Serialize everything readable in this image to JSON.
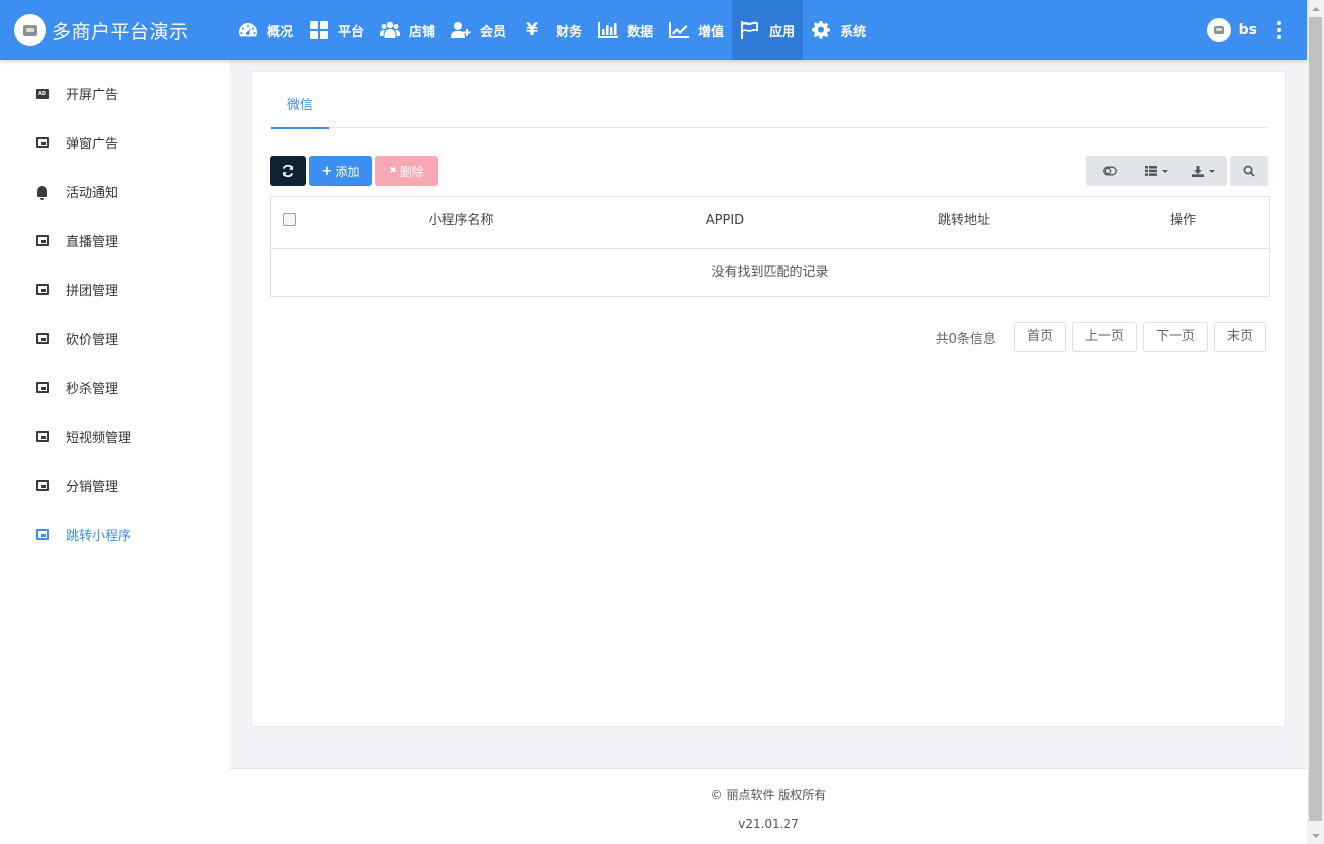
{
  "app": {
    "title": "多商户平台演示"
  },
  "nav": [
    {
      "label": "概况",
      "icon": "dashboard-icon"
    },
    {
      "label": "平台",
      "icon": "grid-icon"
    },
    {
      "label": "店铺",
      "icon": "users-icon"
    },
    {
      "label": "会员",
      "icon": "user-plus-icon"
    },
    {
      "label": "财务",
      "icon": "yen-icon",
      "glyph": "¥"
    },
    {
      "label": "数据",
      "icon": "bar-chart-icon"
    },
    {
      "label": "增值",
      "icon": "line-chart-icon"
    },
    {
      "label": "应用",
      "icon": "flag-icon",
      "active": true
    },
    {
      "label": "系统",
      "icon": "gear-icon"
    }
  ],
  "user": {
    "name": "bs"
  },
  "sidebar": {
    "items": [
      {
        "label": "开屏广告",
        "icon": "ad-icon"
      },
      {
        "label": "弹窗广告",
        "icon": "ad-frame-icon"
      },
      {
        "label": "活动通知",
        "icon": "bell-icon"
      },
      {
        "label": "直播管理",
        "icon": "ad-frame-icon"
      },
      {
        "label": "拼团管理",
        "icon": "ad-frame-icon"
      },
      {
        "label": "砍价管理",
        "icon": "ad-frame-icon"
      },
      {
        "label": "秒杀管理",
        "icon": "ad-frame-icon"
      },
      {
        "label": "短视频管理",
        "icon": "ad-frame-icon"
      },
      {
        "label": "分销管理",
        "icon": "ad-frame-icon"
      },
      {
        "label": "跳转小程序",
        "icon": "ad-frame-icon",
        "active": true
      }
    ]
  },
  "tabs": [
    {
      "label": "微信",
      "active": true
    }
  ],
  "toolbar": {
    "refresh_icon": "refresh-icon",
    "add_label": "添加",
    "add_glyph": "+",
    "delete_label": "删除",
    "delete_glyph": "✖"
  },
  "table": {
    "columns": [
      "小程序名称",
      "APPID",
      "跳转地址",
      "操作"
    ],
    "empty_text": "没有找到匹配的记录"
  },
  "pagination": {
    "info": "共0条信息",
    "first": "首页",
    "prev": "上一页",
    "next": "下一页",
    "last": "末页"
  },
  "footer": {
    "copyright": "© 丽点软件 版权所有",
    "version": "v21.01.27"
  },
  "colors": {
    "primary": "#3c8ff0",
    "topbar_active": "#2f7bd8",
    "dark_button": "#0d2234",
    "danger_light": "#f7a8b5"
  }
}
